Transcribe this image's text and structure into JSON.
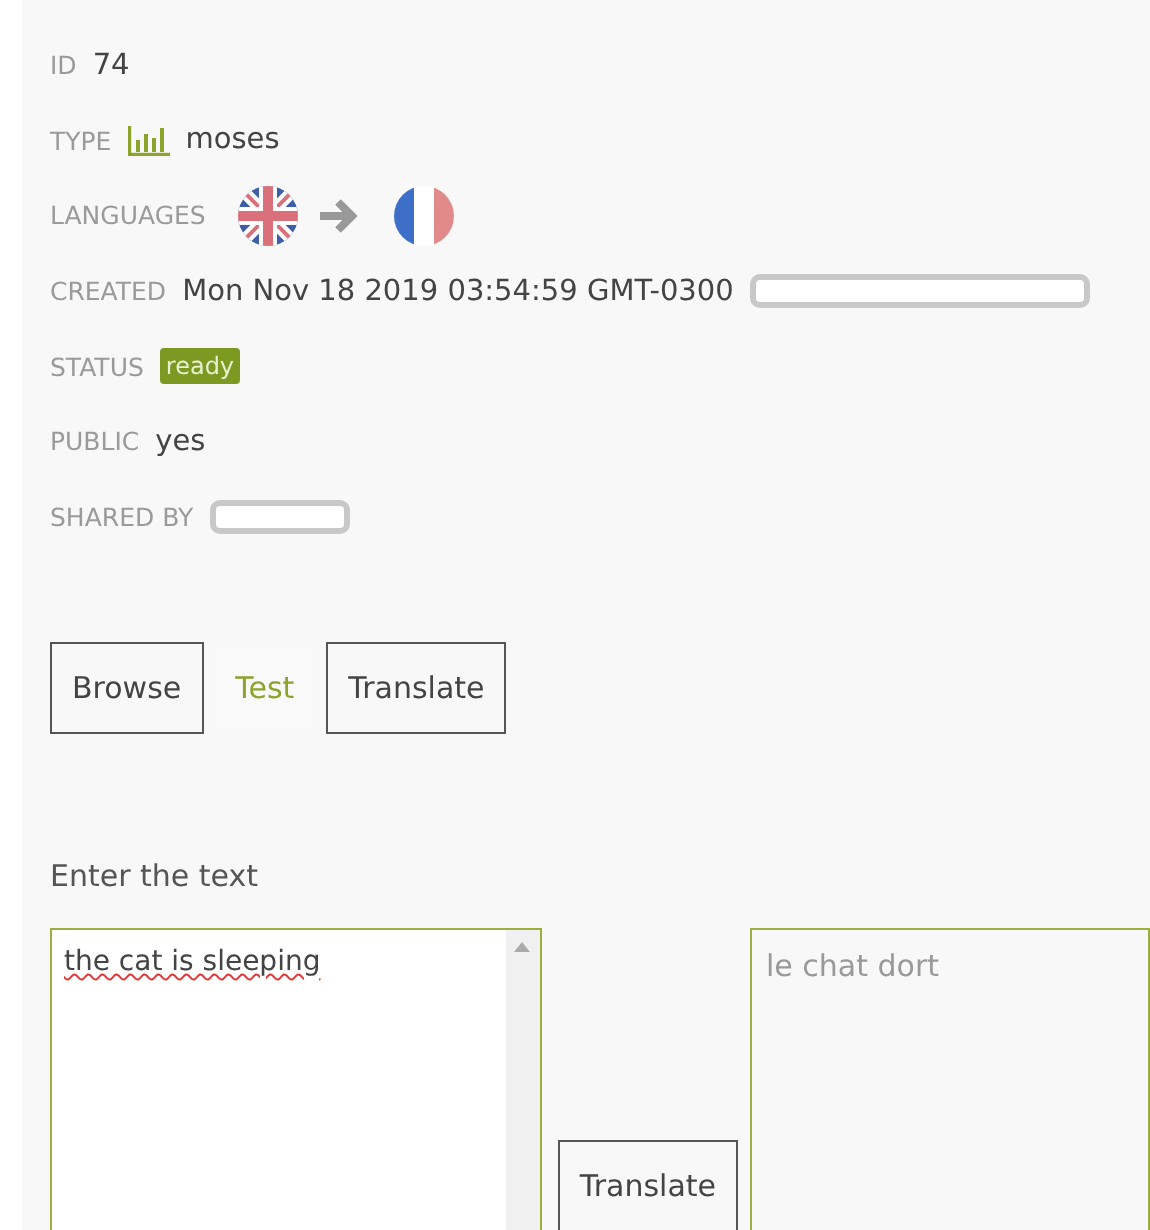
{
  "details": [
    {
      "kind": "text",
      "label": "ID",
      "value": "74"
    },
    {
      "kind": "type",
      "label": "TYPE",
      "value": "moses"
    },
    {
      "kind": "languages",
      "label": "LANGUAGES"
    },
    {
      "kind": "text",
      "label": "CREATED",
      "value": "Mon Nov 18 2019 03:54:59 GMT-0300",
      "redacted": true
    },
    {
      "kind": "badge",
      "label": "STATUS",
      "value": "ready"
    },
    {
      "kind": "text",
      "label": "PUBLIC",
      "value": "yes"
    },
    {
      "kind": "redacted",
      "label": "SHARED BY"
    }
  ],
  "tabs": [
    {
      "label": "Browse",
      "selected": false
    },
    {
      "label": "Test",
      "selected": true
    },
    {
      "label": "Translate",
      "selected": false
    }
  ],
  "test": {
    "prompt": "Enter the text",
    "input": "the cat is sleeping",
    "button": "Translate",
    "output": "le chat dort"
  }
}
